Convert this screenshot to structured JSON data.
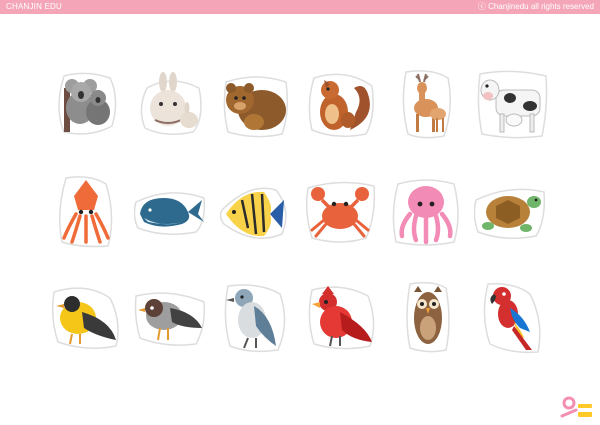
{
  "header": {
    "brand": "CHANJIN EDU",
    "copyright": "ⓒ Chanjinedu all rights reserved",
    "bar_color": "#f4a6b8"
  },
  "stickers": {
    "row1": [
      "koala",
      "rabbit",
      "bear",
      "squirrel",
      "deer",
      "cow"
    ],
    "row2": [
      "squid",
      "whale",
      "angelfish",
      "crab",
      "octopus",
      "turtle"
    ],
    "row3": [
      "yellow-bird",
      "sparrow",
      "blue-jay",
      "cardinal",
      "owl",
      "parrot"
    ]
  },
  "logo": {
    "colors": [
      "#f48fb1",
      "#ffca28"
    ]
  }
}
